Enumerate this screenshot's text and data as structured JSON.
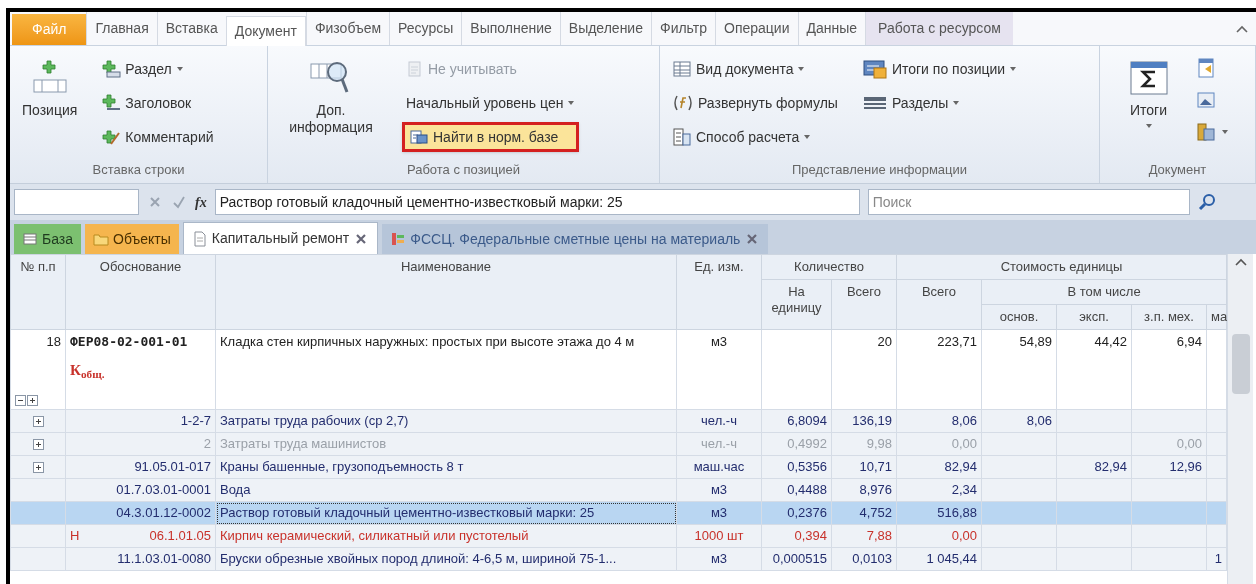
{
  "tabs": [
    {
      "label": "Файл",
      "kind": "file",
      "selected": false
    },
    {
      "label": "Главная",
      "kind": "tab",
      "selected": false
    },
    {
      "label": "Вставка",
      "kind": "tab",
      "selected": false
    },
    {
      "label": "Документ",
      "kind": "tab",
      "selected": true
    },
    {
      "label": "Физобъем",
      "kind": "tab",
      "selected": false
    },
    {
      "label": "Ресурсы",
      "kind": "tab",
      "selected": false
    },
    {
      "label": "Выполнение",
      "kind": "tab",
      "selected": false
    },
    {
      "label": "Выделение",
      "kind": "tab",
      "selected": false
    },
    {
      "label": "Фильтр",
      "kind": "tab",
      "selected": false
    },
    {
      "label": "Операции",
      "kind": "tab",
      "selected": false
    },
    {
      "label": "Данные",
      "kind": "tab",
      "selected": false
    },
    {
      "label": "Работа с ресурсом",
      "kind": "context",
      "selected": false
    }
  ],
  "ribbon": {
    "groups": [
      {
        "label": "Вставка строки",
        "columns": [
          [
            {
              "kind": "large",
              "label": "Позиция",
              "dropdown": false,
              "disabled": false,
              "highlighted": false
            }
          ],
          [
            {
              "kind": "small",
              "label": "Раздел",
              "dropdown": true,
              "disabled": false,
              "highlighted": false
            },
            {
              "kind": "small",
              "label": "Заголовок",
              "dropdown": false,
              "disabled": false,
              "highlighted": false
            },
            {
              "kind": "small",
              "label": "Комментарий",
              "dropdown": false,
              "disabled": false,
              "highlighted": false
            }
          ]
        ]
      },
      {
        "label": "Работа с позицией",
        "columns": [
          [
            {
              "kind": "large",
              "label": "Доп. информация",
              "dropdown": false,
              "disabled": false,
              "highlighted": false
            }
          ],
          [
            {
              "kind": "small",
              "label": "Не учитывать",
              "dropdown": false,
              "disabled": true,
              "highlighted": false
            },
            {
              "kind": "small",
              "label": "Начальный уровень цен",
              "dropdown": true,
              "disabled": false,
              "highlighted": false
            },
            {
              "kind": "small",
              "label": "Найти в норм. базе",
              "dropdown": false,
              "disabled": false,
              "highlighted": true
            }
          ]
        ]
      },
      {
        "label": "Представление информации",
        "columns": [
          [
            {
              "kind": "small",
              "label": "Вид документа",
              "dropdown": true,
              "disabled": false,
              "highlighted": false
            },
            {
              "kind": "small",
              "label": "Развернуть формулы",
              "dropdown": false,
              "disabled": false,
              "highlighted": false
            },
            {
              "kind": "small",
              "label": "Способ расчета",
              "dropdown": true,
              "disabled": false,
              "highlighted": false
            }
          ],
          [
            {
              "kind": "small",
              "label": "Итоги по позиции",
              "dropdown": true,
              "disabled": false,
              "highlighted": false
            },
            {
              "kind": "small",
              "label": "Разделы",
              "dropdown": true,
              "disabled": false,
              "highlighted": false
            }
          ]
        ]
      },
      {
        "label": "Документ",
        "columns": [
          [
            {
              "kind": "large",
              "label": "Итоги",
              "dropdown": true,
              "disabled": false,
              "highlighted": false
            }
          ],
          [
            {
              "kind": "icon",
              "dropdown": false,
              "disabled": false,
              "highlighted": false
            },
            {
              "kind": "icon",
              "dropdown": false,
              "disabled": false,
              "highlighted": false
            },
            {
              "kind": "icon",
              "dropdown": true,
              "disabled": false,
              "highlighted": false
            }
          ]
        ]
      }
    ]
  },
  "formula_bar": {
    "function_label": "fx",
    "value": "Раствор готовый кладочный цементно-известковый марки: 25",
    "search_placeholder": "Поиск"
  },
  "document_tabs": [
    {
      "label": "База",
      "kind": "base",
      "selected": false,
      "closable": false
    },
    {
      "label": "Объекты",
      "kind": "objects",
      "selected": false,
      "closable": false
    },
    {
      "label": "Капитальный ремонт",
      "kind": "document",
      "selected": true,
      "closable": true
    },
    {
      "label": "ФССЦ. Федеральные сметные цены на материаль",
      "kind": "catalog",
      "selected": false,
      "closable": true
    }
  ],
  "table": {
    "header": {
      "num": "№ п.п",
      "basis": "Обоснование",
      "name": "Наименование",
      "unit": "Ед. изм.",
      "quantity": {
        "label": "Количество",
        "per_unit": "На единицу",
        "total": "Всего"
      },
      "unit_cost": {
        "label": "Стоимость единицы",
        "total": "Всего",
        "including": {
          "label": "В том числе",
          "columns": [
            "основ.",
            "эксп.",
            "з.п. мех.",
            "ма"
          ]
        }
      }
    },
    "rows": [
      {
        "kind": "position",
        "num": "18",
        "basis": "ФЕР08-02-001-01",
        "coefficient": "К$_{общ.}$",
        "name": "Кладка стен кирпичных наружных: простых при высоте этажа до 4 м",
        "unit": "м3",
        "total": "20",
        "cost": "223,71",
        "osnov": "54,89",
        "ekspl": "44,42",
        "zp_mech": "6,94",
        "selected": false,
        "disabled": false,
        "unaccounted": false
      },
      {
        "kind": "group",
        "basis": "1-2-7",
        "name": "Затраты труда рабочих (ср 2,7)",
        "unit": "чел.-ч",
        "per_unit": "6,8094",
        "total": "136,19",
        "cost": "8,06",
        "osnov": "8,06",
        "selected": false,
        "disabled": false,
        "unaccounted": false
      },
      {
        "kind": "group",
        "basis": "2",
        "name": "Затраты труда машинистов",
        "unit": "чел.-ч",
        "per_unit": "0,4992",
        "total": "9,98",
        "cost": "0,00",
        "zp_mech": "0,00",
        "selected": false,
        "disabled": true,
        "unaccounted": false
      },
      {
        "kind": "group",
        "basis": "91.05.01-017",
        "name": "Краны башенные, грузоподъемность 8 т",
        "unit": "маш.час",
        "per_unit": "0,5356",
        "total": "10,71",
        "cost": "82,94",
        "ekspl": "82,94",
        "zp_mech": "12,96",
        "selected": false,
        "disabled": false,
        "unaccounted": false
      },
      {
        "kind": "resource",
        "basis": "01.7.03.01-0001",
        "name": "Вода",
        "unit": "м3",
        "per_unit": "0,4488",
        "total": "8,976",
        "cost": "2,34",
        "selected": false,
        "disabled": false,
        "unaccounted": false
      },
      {
        "kind": "resource",
        "basis": "04.3.01.12-0002",
        "name": "Раствор готовый кладочный цементно-известковый марки: 25",
        "unit": "м3",
        "per_unit": "0,2376",
        "total": "4,752",
        "cost": "516,88",
        "selected": true,
        "disabled": false,
        "unaccounted": false
      },
      {
        "kind": "resource",
        "marker": "Н",
        "basis": "06.1.01.05",
        "name": "Кирпич керамический, силикатный или пустотелый",
        "unit": "1000 шт",
        "per_unit": "0,394",
        "total": "7,88",
        "cost": "0,00",
        "selected": false,
        "disabled": false,
        "unaccounted": true
      },
      {
        "kind": "resource",
        "basis": "11.1.03.01-0080",
        "name": "Бруски обрезные хвойных пород длиной: 4-6,5 м, шириной 75-1...",
        "unit": "м3",
        "per_unit": "0,000515",
        "total": "0,0103",
        "cost": "1 045,44",
        "col_ma": "1",
        "selected": false,
        "disabled": false,
        "unaccounted": false
      }
    ]
  }
}
